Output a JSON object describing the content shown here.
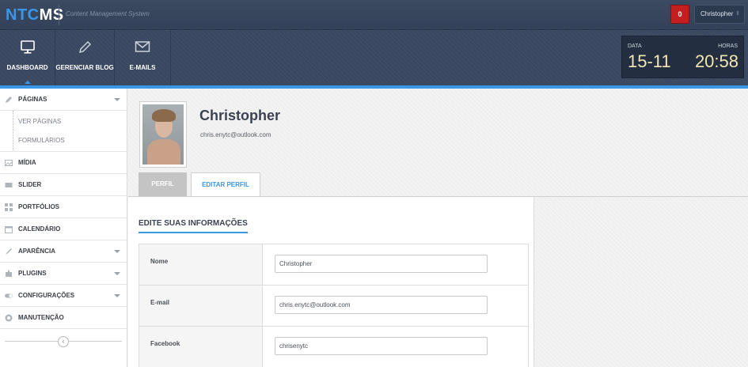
{
  "header": {
    "logo_nt": "NTC",
    "logo_cms": "MS",
    "subtitle": "Content Management System",
    "notifications": "0",
    "user": "Christopher",
    "user_arrow": "⇕"
  },
  "nav": {
    "items": [
      {
        "label": "DASHBOARD",
        "icon": "monitor-icon",
        "active": true
      },
      {
        "label": "GERENCIAR BLOG",
        "icon": "pencil-icon",
        "active": false
      },
      {
        "label": "E-MAILS",
        "icon": "envelope-icon",
        "active": false
      }
    ],
    "datetime": {
      "date_label": "DATA",
      "date": "15-11",
      "time_label": "HORAS",
      "time": "20:58"
    }
  },
  "sidebar": {
    "items": [
      {
        "label": "PÁGINAS",
        "icon": "pencil-icon",
        "has_submenu": true
      },
      {
        "label": "MÍDIA",
        "icon": "media-icon",
        "has_submenu": false
      },
      {
        "label": "SLIDER",
        "icon": "slider-icon",
        "has_submenu": false
      },
      {
        "label": "PORTFÓLIOS",
        "icon": "grid-icon",
        "has_submenu": false
      },
      {
        "label": "CALENDÁRIO",
        "icon": "calendar-icon",
        "has_submenu": false
      },
      {
        "label": "APARÊNCIA",
        "icon": "brush-icon",
        "has_submenu": true
      },
      {
        "label": "PLUGINS",
        "icon": "puzzle-icon",
        "has_submenu": true
      },
      {
        "label": "CONFIGURAÇÕES",
        "icon": "toggle-icon",
        "has_submenu": true
      },
      {
        "label": "MANUTENÇÃO",
        "icon": "lifebuoy-icon",
        "has_submenu": false
      }
    ],
    "subitems": [
      {
        "label": "VER PÁGINAS"
      },
      {
        "label": "FORMULÁRIOS"
      }
    ],
    "collapse_glyph": "‹"
  },
  "profile": {
    "name": "Christopher",
    "email": "chris.enytc@outlook.com"
  },
  "tabs": [
    {
      "label": "PERFIL",
      "active": false
    },
    {
      "label": "EDITAR PERFIL",
      "active": true
    }
  ],
  "form": {
    "title": "EDITE SUAS INFORMAÇÕES",
    "rows": [
      {
        "label": "Nome",
        "value": "Christopher"
      },
      {
        "label": "E-mail",
        "value": "chris.enytc@outlook.com"
      },
      {
        "label": "Facebook",
        "value": "chrisenytc"
      }
    ]
  },
  "colors": {
    "accent": "#3a96e6",
    "header_bg": "#3b4a60",
    "notification": "#c41f1f",
    "clock_digits": "#f2e6b0"
  }
}
